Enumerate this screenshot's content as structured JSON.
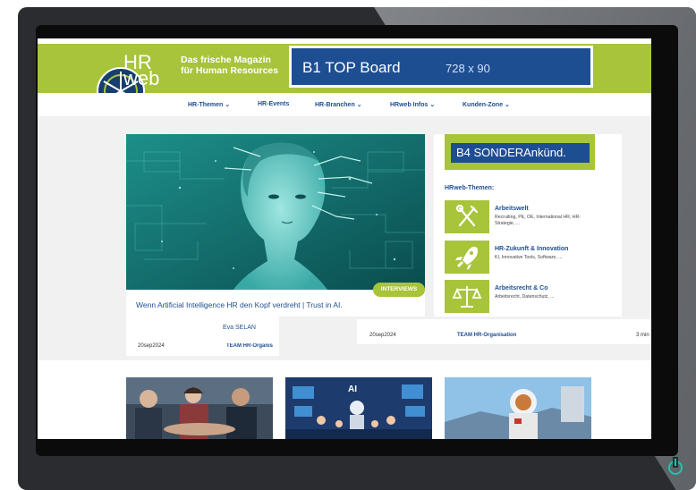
{
  "site": {
    "logo_top": "HR",
    "logo_bottom": "web",
    "tagline_1": "Das frische Magazin",
    "tagline_2": "für Human Resources"
  },
  "banner": {
    "label": "B1 TOP Board",
    "size": "728 x 90"
  },
  "nav": [
    {
      "label": "HR-Themen ⌄"
    },
    {
      "label": "HR-Events"
    },
    {
      "label": "HR-Branchen ⌄"
    },
    {
      "label": "HRweb Infos ⌄"
    },
    {
      "label": "Kunden-Zone ⌄"
    }
  ],
  "hero": {
    "badge": "INTERVIEWS",
    "title": "Wenn Artificial Intelligence HR den Kopf verdreht | Trust in AI.",
    "author": "Eva SELAN",
    "date": "20sep2024",
    "team": "TEAM HR-Organis"
  },
  "sidebar": {
    "ad_label": "B4 SONDERAnkünd.",
    "themes_heading": "HRweb-Themen:",
    "themes": [
      {
        "title": "Arbeitswelt",
        "desc": "Recruiting, PE, OE, International HR, HR-Strategie, ..."
      },
      {
        "title": "HR-Zukunft & Innovation",
        "desc": "KI, Innovative Tools, Software, ..."
      },
      {
        "title": "Arbeitsrecht & Co",
        "desc": "Arbeitsrecht, Datenschutz, ..."
      }
    ]
  },
  "second": {
    "date": "20sep2024",
    "team": "TEAM HR-Organisation",
    "read_time": "3 min"
  },
  "colors": {
    "brand_green": "#a8c43a",
    "brand_blue": "#1e4e92",
    "power_led": "#15c9b0"
  }
}
